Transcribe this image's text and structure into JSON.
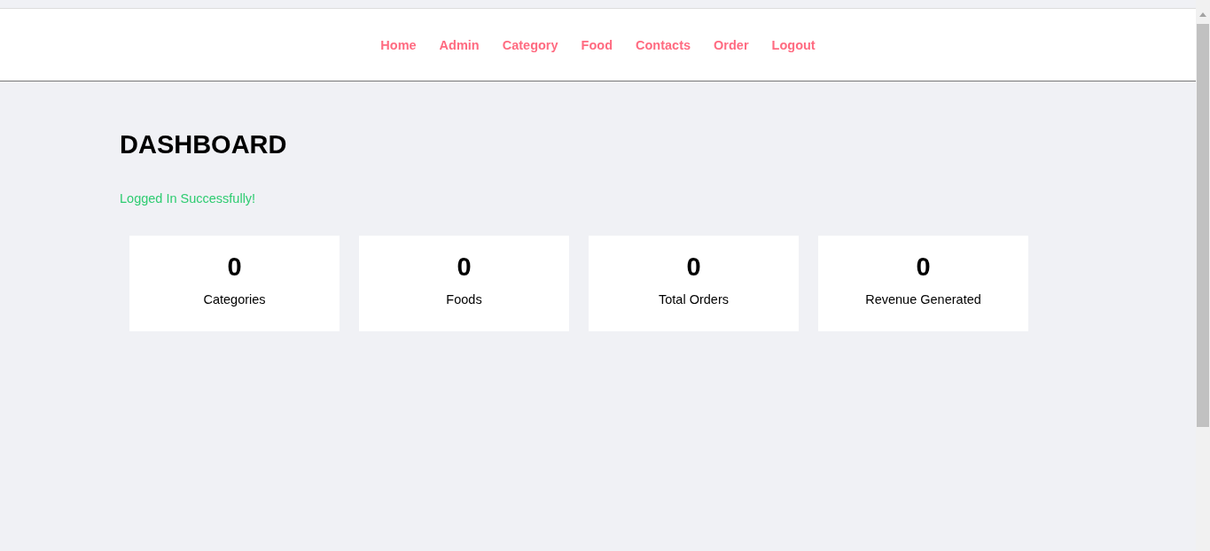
{
  "nav": {
    "items": [
      {
        "label": "Home"
      },
      {
        "label": "Admin"
      },
      {
        "label": "Category"
      },
      {
        "label": "Food"
      },
      {
        "label": "Contacts"
      },
      {
        "label": "Order"
      },
      {
        "label": "Logout"
      }
    ]
  },
  "main": {
    "title": "DASHBOARD",
    "message": "Logged In Successfully!",
    "stats": [
      {
        "value": "0",
        "label": "Categories"
      },
      {
        "value": "0",
        "label": "Foods"
      },
      {
        "value": "0",
        "label": "Total Orders"
      },
      {
        "value": "0",
        "label": "Revenue Generated"
      }
    ]
  }
}
